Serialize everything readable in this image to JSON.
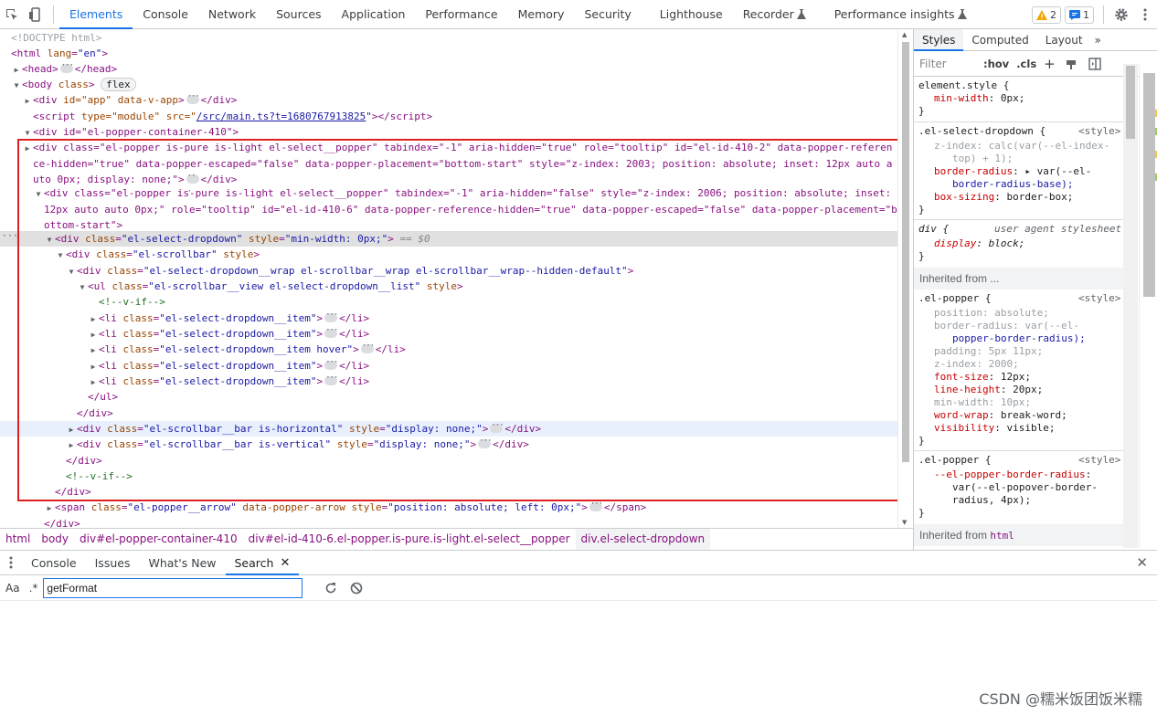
{
  "toolbar": {
    "tabs": [
      "Elements",
      "Console",
      "Network",
      "Sources",
      "Application",
      "Performance",
      "Memory",
      "Security",
      "Lighthouse",
      "Recorder",
      "Performance insights"
    ],
    "active_tab": "Elements",
    "warning_count": "2",
    "message_count": "1",
    "icons": [
      "inspect-icon",
      "device-toggle-icon",
      "warning-icon",
      "message-icon",
      "settings-icon",
      "more-icon"
    ]
  },
  "dom": {
    "doctype": "<!DOCTYPE html>",
    "html_open": "html",
    "html_lang_attr": "lang",
    "html_lang_val": "\"en\"",
    "head": "head",
    "body_open": "body",
    "body_class_attr": "class",
    "body_badge": "flex",
    "app_div_tag": "div",
    "app_div_attrs": "id=\"app\" data-v-app",
    "script_tag": "script",
    "script_attrs_pre": "type=\"module\" src=\"",
    "script_src": "/src/main.ts?t=1680767913825",
    "popper_container": "div id=\"el-popper-container-410\"",
    "popper1_text": "<div class=\"el-popper is-pure is-light el-select__popper\" tabindex=\"-1\" aria-hidden=\"true\" role=\"tooltip\" id=\"el-id-410-2\" data-popper-reference-hidden=\"true\" data-popper-escaped=\"false\" data-popper-placement=\"bottom-start\" style=\"z-index: 2003; position: absolute; inset: 12px auto auto 0px; display: none;\">",
    "popper2_text": "<div class=\"el-popper is-pure is-light el-select__popper\" tabindex=\"-1\" aria-hidden=\"false\" style=\"z-index: 2006; position: absolute; inset: 12px auto auto 0px;\" role=\"tooltip\" id=\"el-id-410-6\" data-popper-reference-hidden=\"true\" data-popper-escaped=\"false\" data-popper-placement=\"bottom-start\">",
    "dropdown_class": "\"el-select-dropdown\"",
    "dropdown_style": "\"min-width: 0px;\"",
    "eq_marker": "== $0",
    "scrollbar_class": "\"el-scrollbar\"",
    "wrap_class": "\"el-select-dropdown__wrap el-scrollbar__wrap el-scrollbar__wrap--hidden-default\"",
    "ul_class": "\"el-scrollbar__view el-select-dropdown__list\"",
    "comment_vif": "<!--v-if-->",
    "items": [
      "\"el-select-dropdown__item\"",
      "\"el-select-dropdown__item\"",
      "\"el-select-dropdown__item hover\"",
      "\"el-select-dropdown__item\"",
      "\"el-select-dropdown__item\""
    ],
    "bar_h_class": "\"el-scrollbar__bar is-horizontal\"",
    "bar_v_class": "\"el-scrollbar__bar is-vertical\"",
    "bar_style": "\"display: none;\"",
    "arrow_class": "\"el-popper__arrow\"",
    "arrow_style": "\"position: absolute; left: 0px;\"",
    "highlight_color": "#e02020"
  },
  "breadcrumbs": [
    "html",
    "body",
    "div#el-popper-container-410",
    "div#el-id-410-6.el-popper.is-pure.is-light.el-select__popper",
    "div.el-select-dropdown"
  ],
  "styles": {
    "tabs": [
      "Styles",
      "Computed",
      "Layout"
    ],
    "active_tab": "Styles",
    "filter_placeholder": "Filter",
    "hov": ":hov",
    "cls": ".cls",
    "element_style_sel": "element.style {",
    "element_style_prop": "min-width",
    "element_style_val": "0px;",
    "dropdown_sel": ".el-select-dropdown {",
    "src_style": "<style>",
    "zindex_prop": "z-index",
    "zindex_val1": "calc(var(--el-index-",
    "zindex_val2": "top) + 1);",
    "br_prop": "border-radius",
    "br_val1": "var(--el-",
    "br_val2": "border-radius-base);",
    "bs_prop": "box-sizing",
    "bs_val": "border-box;",
    "div_sel": "div {",
    "ua": "user agent stylesheet",
    "display_prop": "display",
    "display_val": "block;",
    "inherited_from": "Inherited from ...",
    "popper_sel": ".el-popper {",
    "p_props": [
      {
        "name": "position",
        "val": "absolute;",
        "dis": true
      },
      {
        "name": "border-radius",
        "val": "var(--el-",
        "dis": true
      },
      {
        "name": "",
        "val": "popper-border-radius);",
        "dis": true
      },
      {
        "name": "padding",
        "val": "5px 11px;",
        "dis": true
      },
      {
        "name": "z-index",
        "val": "2000;",
        "dis": true
      },
      {
        "name": "font-size",
        "val": "12px;",
        "dis": false
      },
      {
        "name": "line-height",
        "val": "20px;",
        "dis": false
      },
      {
        "name": "min-width",
        "val": "10px;",
        "dis": true
      },
      {
        "name": "word-wrap",
        "val": "break-word;",
        "dis": false
      },
      {
        "name": "visibility",
        "val": "visible;",
        "dis": false
      }
    ],
    "popper2_prop": "--el-popper-border-radius",
    "popper2_val1": "var(--el-popover-border-",
    "popper2_val2": "radius, 4px);",
    "inherited_html_pre": "Inherited from",
    "inherited_html_tag": "html"
  },
  "drawer": {
    "tabs": [
      "Console",
      "Issues",
      "What's New",
      "Search"
    ],
    "active_tab": "Search",
    "aa": "Aa",
    "regex": ".*",
    "search_value": "getFormat"
  },
  "watermark": "CSDN @糯米饭团饭米糯"
}
